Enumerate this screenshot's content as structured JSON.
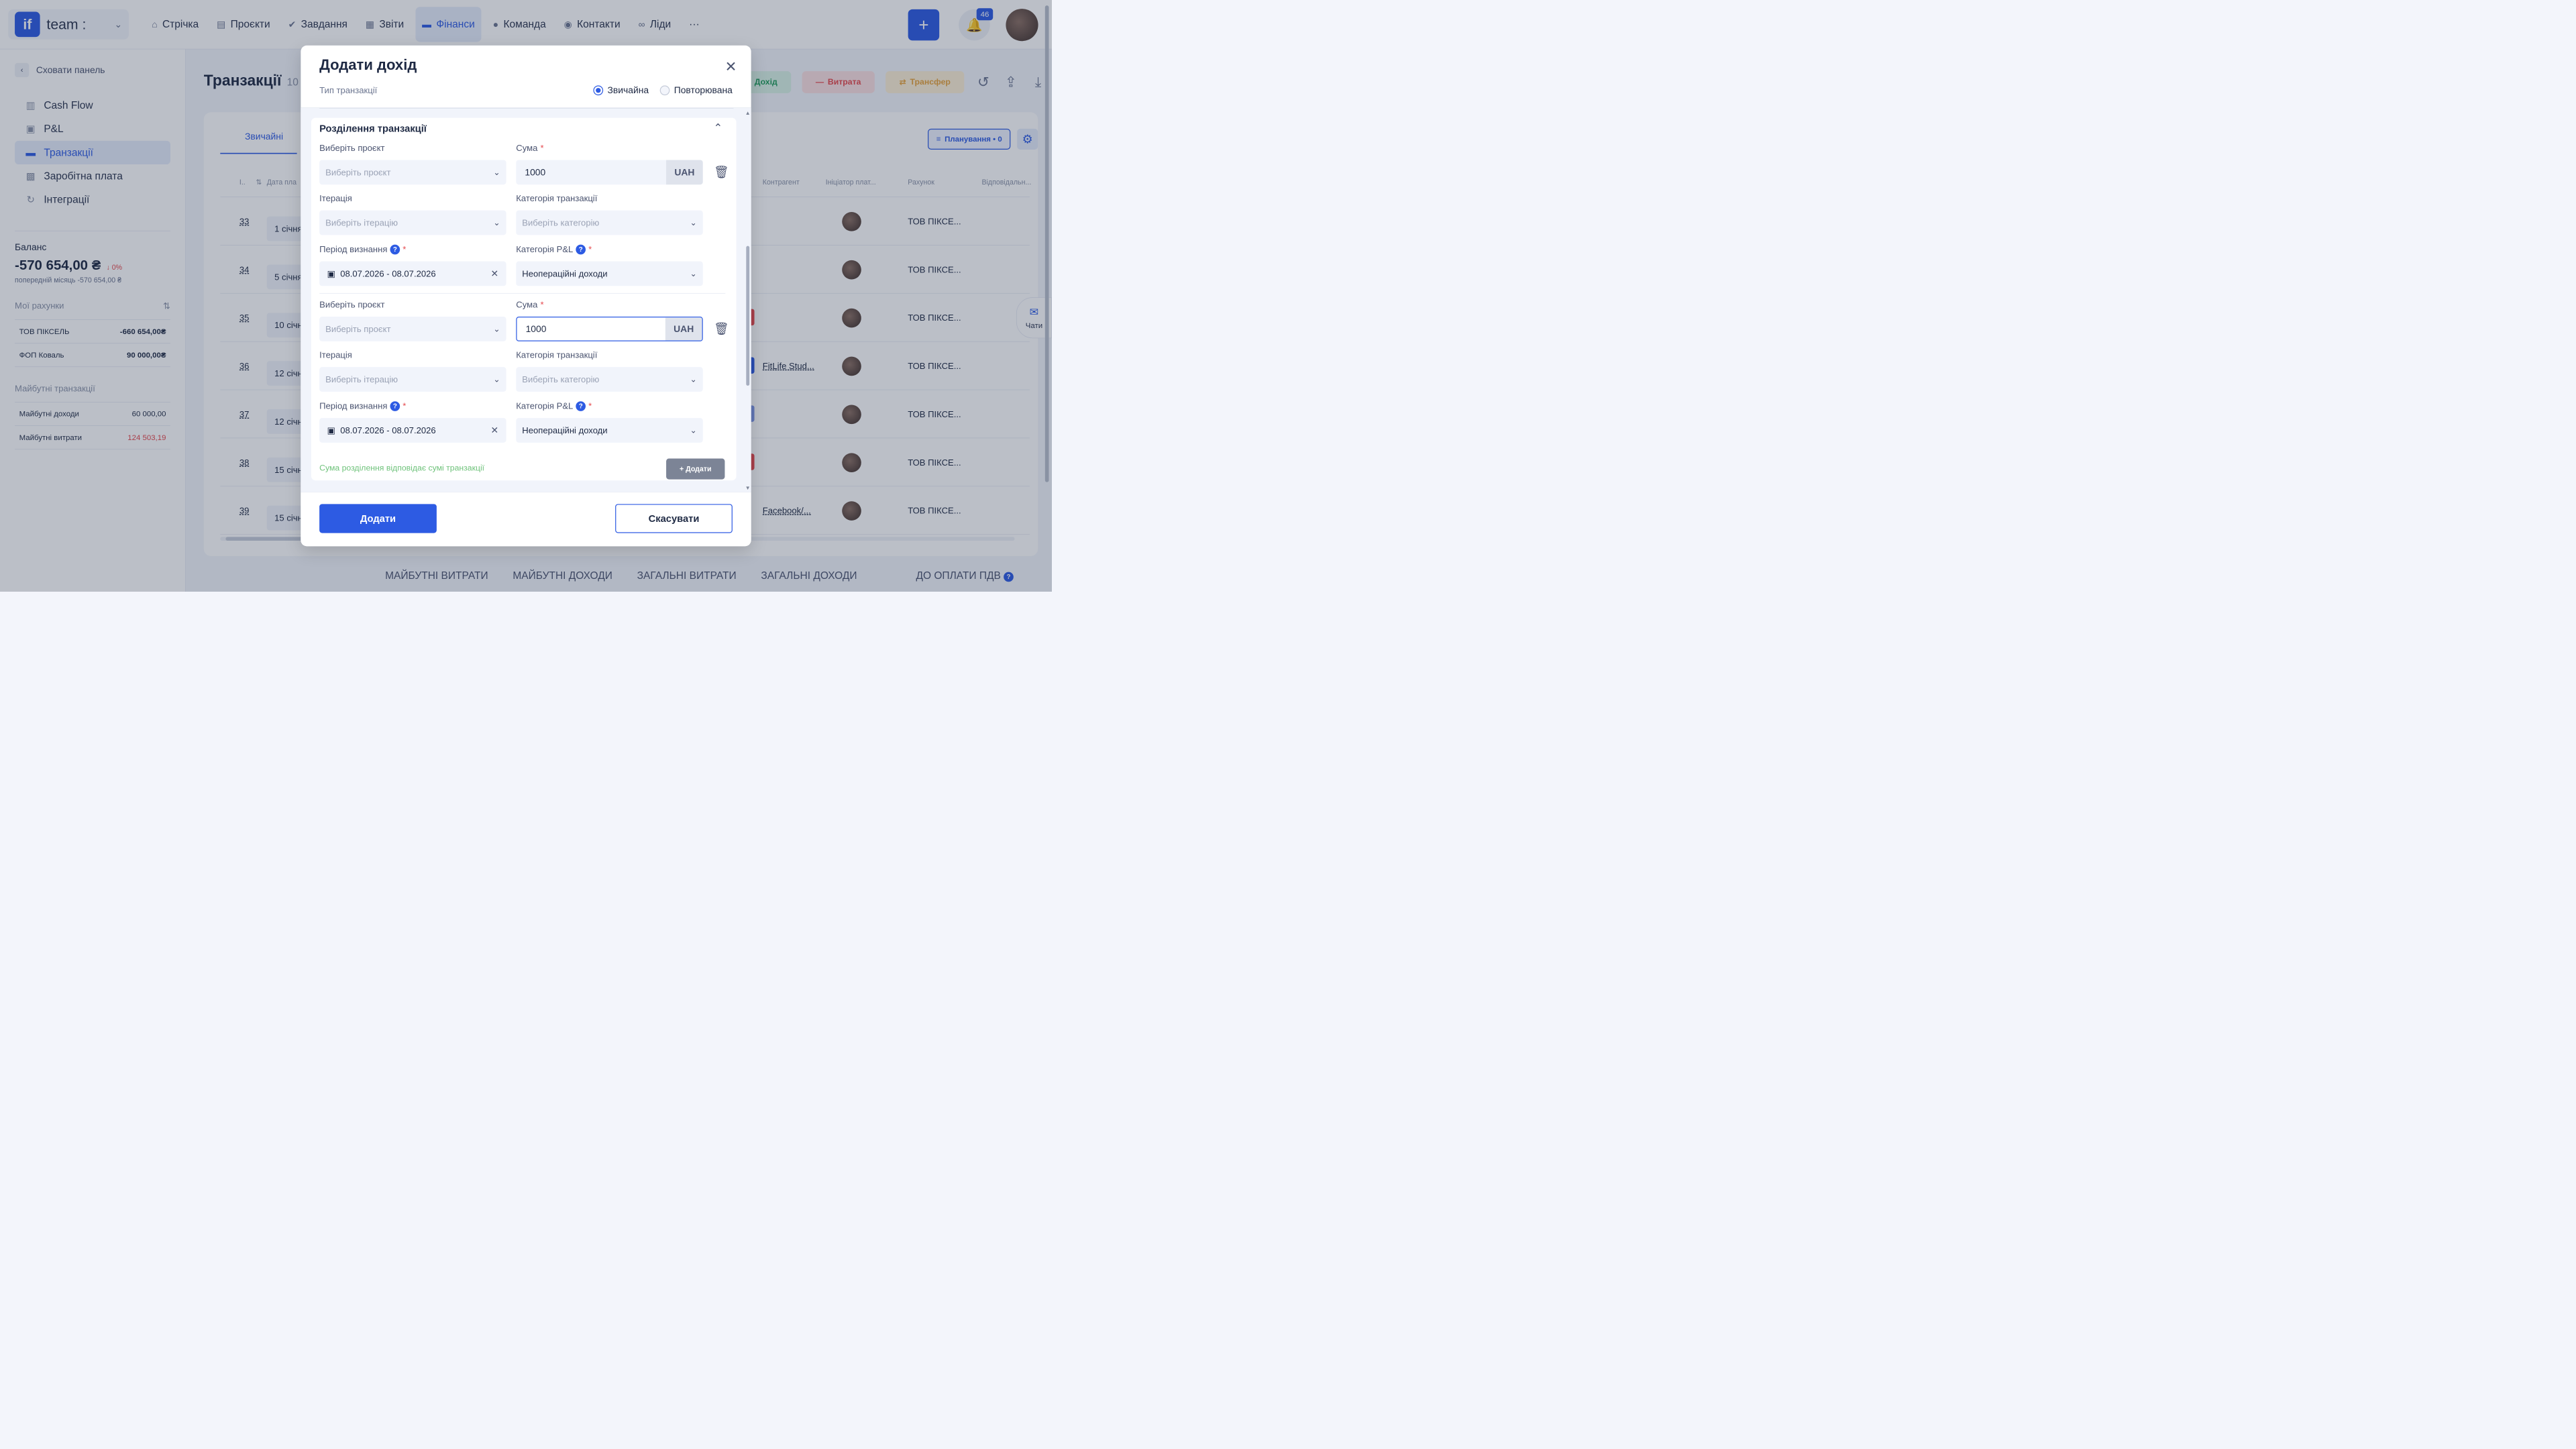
{
  "topbar": {
    "team_name": "team :",
    "logo_text": "if",
    "nav": [
      "Стрічка",
      "Проєкти",
      "Завдання",
      "Звіти",
      "Фінанси",
      "Команда",
      "Контакти",
      "Ліди"
    ],
    "more": "···",
    "add": "+",
    "notifications": "46"
  },
  "sidebar": {
    "hide_panel": "Сховати панель",
    "items": [
      "Cash Flow",
      "P&L",
      "Транзакції",
      "Заробітна плата",
      "Інтеграції"
    ],
    "balance_label": "Баланс",
    "balance_value": "-570 654,00 ₴",
    "balance_delta": "↓ 0%",
    "prev_month_label": "попередній місяць",
    "prev_month_value": "-570 654,00 ₴",
    "my_accounts": "Мої рахунки",
    "accounts": [
      {
        "name": "ТОВ ПІКСЕЛЬ",
        "value": "-660 654,00₴"
      },
      {
        "name": "ФОП Коваль",
        "value": "90 000,00₴"
      }
    ],
    "future_label": "Майбутні транзакції",
    "future": [
      {
        "name": "Майбутні доходи",
        "value": "60 000,00"
      },
      {
        "name": "Майбутні витрати",
        "value": "124 503,19"
      }
    ]
  },
  "main": {
    "title": "Транзакції",
    "count": "10",
    "btn_income": "Дохід",
    "btn_expense": "Витрата",
    "btn_transfer": "Трансфер",
    "tab_regular": "Звичайні",
    "planning": "Планування • 0",
    "cols": [
      "I..",
      "⇅",
      "Дата пла",
      "Контрагент",
      "Ініціатор плат...",
      "Рахунок",
      "Відповідальн..."
    ],
    "rows": [
      {
        "num": "33",
        "date": "1 січня,",
        "ctr": "",
        "acc": "ТОВ ПІКСЕ..."
      },
      {
        "num": "34",
        "date": "5 січня,",
        "ctr": "",
        "acc": "ТОВ ПІКСЕ..."
      },
      {
        "num": "35",
        "date": "10 січня",
        "ctr": "",
        "acc": "ТОВ ПІКСЕ..."
      },
      {
        "num": "36",
        "date": "12 січня",
        "ctr": "FitLife Stud...",
        "acc": "ТОВ ПІКСЕ..."
      },
      {
        "num": "37",
        "date": "12 січня",
        "ctr": "",
        "acc": "ТОВ ПІКСЕ..."
      },
      {
        "num": "38",
        "date": "15 січня",
        "ctr": "",
        "acc": "ТОВ ПІКСЕ..."
      },
      {
        "num": "39",
        "date": "15 січня",
        "ctr": "Facebook/...",
        "acc": "ТОВ ПІКСЕ..."
      }
    ],
    "bottom_links": [
      "МАЙБУТНІ ВИТРАТИ",
      "МАЙБУТНІ ДОХОДИ",
      "ЗАГАЛЬНІ ВИТРАТИ",
      "ЗАГАЛЬНІ ДОХОДИ"
    ],
    "vat_link": "ДО ОПЛАТИ ПДВ",
    "chats": "Чати"
  },
  "modal": {
    "title": "Додати дохід",
    "type_label": "Тип транзакції",
    "type_regular": "Звичайна",
    "type_recurring": "Повторювана",
    "split_title": "Розділення транзакції",
    "label_project": "Виберіть проєкт",
    "label_amount": "Сума",
    "label_iteration": "Ітерація",
    "label_category": "Категорія транзакції",
    "label_period": "Період визнання",
    "label_pl": "Категорія P&L",
    "placeholder_project": "Виберіть проєкт",
    "placeholder_iteration": "Виберіть ітерацію",
    "placeholder_category": "Виберіть категорію",
    "currency": "UAH",
    "splits": [
      {
        "amount": "1000",
        "period": "08.07.2026 - 08.07.2026",
        "pl_category": "Неопераційні доходи"
      },
      {
        "amount": "1000",
        "period": "08.07.2026 - 08.07.2026",
        "pl_category": "Неопераційні доходи"
      }
    ],
    "match_message": "Сума розділення відповідає сумі транзакції",
    "add_split": "+ Додати",
    "submit": "Додати",
    "cancel": "Скасувати"
  }
}
